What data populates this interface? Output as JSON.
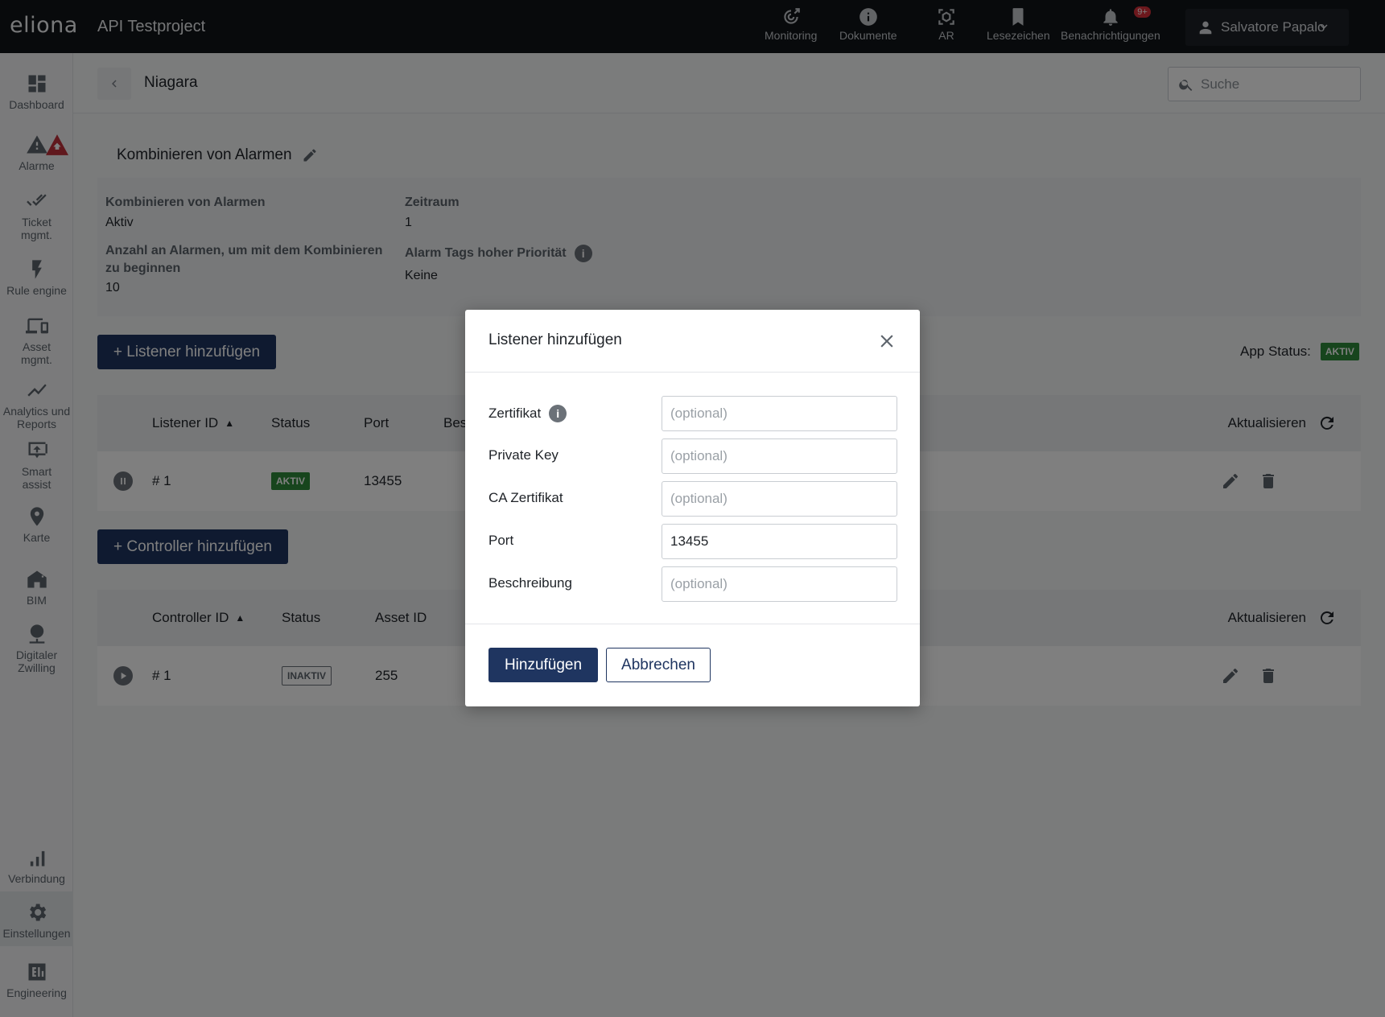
{
  "topbar": {
    "logo": "eliona",
    "app_title": "API Testproject",
    "nav": [
      {
        "label": "Monitoring",
        "icon": "monitoring-icon"
      },
      {
        "label": "Dokumente",
        "icon": "info-icon"
      },
      {
        "label": "AR",
        "icon": "ar-cube-icon"
      },
      {
        "label": "Lesezeichen",
        "icon": "bookmark-icon"
      },
      {
        "label": "Benachrichtigungen",
        "icon": "bell-icon",
        "badge": "9+"
      }
    ],
    "user_name": "Salvatore Papalo"
  },
  "sidebar": {
    "items": [
      {
        "label": "Dashboard",
        "icon": "dashboard-icon"
      },
      {
        "label": "Alarme",
        "icon": "alarm-icon"
      },
      {
        "label": "Ticket mgmt.",
        "icon": "ticket-check-icon"
      },
      {
        "label": "Rule engine",
        "icon": "bolt-icon"
      },
      {
        "label": "Asset mgmt.",
        "icon": "devices-icon"
      },
      {
        "label": "Analytics und Reports",
        "icon": "trend-icon"
      },
      {
        "label": "Smart assist",
        "icon": "smart-assist-icon"
      },
      {
        "label": "Karte",
        "icon": "map-pin-icon"
      },
      {
        "label": "BIM",
        "icon": "building-icon"
      },
      {
        "label": "Digitaler Zwilling",
        "icon": "digital-twin-icon"
      },
      {
        "label": "Verbindung",
        "icon": "signal-bars-icon"
      },
      {
        "label": "Einstellungen",
        "icon": "gear-icon"
      },
      {
        "label": "Engineering",
        "icon": "eli-icon"
      }
    ]
  },
  "breadcrumb": {
    "title": "Niagara"
  },
  "search": {
    "placeholder": "Suche"
  },
  "section": {
    "title": "Kombinieren von Alarmen",
    "fields": {
      "combine_label": "Kombinieren von Alarmen",
      "combine_value": "Aktiv",
      "count_label": "Anzahl an Alarmen, um mit dem Kombinieren zu beginnen",
      "count_value": "10",
      "period_label": "Zeitraum",
      "period_value": "1",
      "tags_label": "Alarm Tags hoher Priorität",
      "tags_value": "Keine"
    }
  },
  "listener": {
    "add_button": "+ Listener hinzufügen",
    "app_status_label": "App Status:",
    "app_status_value": "AKTIV",
    "columns": [
      "Listener ID",
      "Status",
      "Port",
      "Bes"
    ],
    "refresh_label": "Aktualisieren",
    "rows": [
      {
        "id": "# 1",
        "status": "AKTIV",
        "port": "13455"
      }
    ]
  },
  "controller": {
    "add_button": "+ Controller hinzufügen",
    "columns": [
      "Controller ID",
      "Status",
      "Asset ID"
    ],
    "refresh_label": "Aktualisieren",
    "rows": [
      {
        "id": "# 1",
        "status": "INAKTIV",
        "asset_id": "255"
      }
    ]
  },
  "modal": {
    "title": "Listener hinzufügen",
    "fields": [
      {
        "label": "Zertifikat",
        "value": "",
        "placeholder": "(optional)",
        "has_info": true
      },
      {
        "label": "Private Key",
        "value": "",
        "placeholder": "(optional)"
      },
      {
        "label": "CA Zertifikat",
        "value": "",
        "placeholder": "(optional)"
      },
      {
        "label": "Port",
        "value": "13455",
        "placeholder": ""
      },
      {
        "label": "Beschreibung",
        "value": "",
        "placeholder": "(optional)"
      }
    ],
    "submit_label": "Hinzufügen",
    "cancel_label": "Abbrechen"
  },
  "colors": {
    "primary": "#1f3560",
    "active_tag": "#2e8b3a",
    "topbar": "#111418",
    "badge": "#d9303a"
  }
}
